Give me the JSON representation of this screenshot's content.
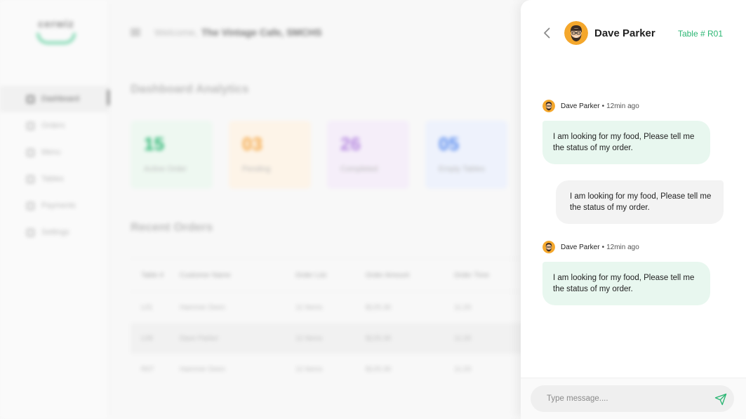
{
  "background": {
    "logo": {
      "text": "cerwiz"
    },
    "nav": [
      {
        "label": "Dashboard",
        "active": true
      },
      {
        "label": "Orders",
        "active": false
      },
      {
        "label": "Menu",
        "active": false
      },
      {
        "label": "Tables",
        "active": false
      },
      {
        "label": "Payments",
        "active": false
      },
      {
        "label": "Settings",
        "active": false
      }
    ],
    "header": {
      "welcome": "Welcome,",
      "venue": "The Vintage Cafe, SMCHS"
    },
    "analytics_title": "Dashboard Analytics",
    "cards": [
      {
        "value": "15",
        "label": "Active Order",
        "color": "#2bb673",
        "bg": "#eef8f1"
      },
      {
        "value": "03",
        "label": "Pending",
        "color": "#f5a94a",
        "bg": "#fdf4e8"
      },
      {
        "value": "26",
        "label": "Completed",
        "color": "#b68ae0",
        "bg": "#f5eef9"
      },
      {
        "value": "05",
        "label": "Empty Tables",
        "color": "#5b8def",
        "bg": "#eef2fc"
      }
    ],
    "recent_title": "Recent Orders",
    "table": {
      "columns": [
        "Table #",
        "Customer Name",
        "Order List",
        "Order Amount",
        "Order Time"
      ],
      "rows": [
        [
          "L01",
          "Hammer Deen",
          "12 Items",
          "$125.30",
          "11:20"
        ],
        [
          "L09",
          "Dave Parker",
          "12 Items",
          "$125.30",
          "11:20"
        ],
        [
          "R07",
          "Hammer Deen",
          "12 Items",
          "$125.30",
          "11:20"
        ]
      ]
    }
  },
  "chat": {
    "contact_name": "Dave Parker",
    "table_label": "Table # R01",
    "messages": [
      {
        "direction": "in",
        "sender": "Dave Parker",
        "time": "12min ago",
        "text": "I am looking for my food, Please tell me the status of my order."
      },
      {
        "direction": "out",
        "text": "I am looking for my food, Please tell me the status of my order."
      },
      {
        "direction": "in",
        "sender": "Dave Parker",
        "time": "12min ago",
        "text": "I am looking for my food, Please tell me the status of my order."
      }
    ],
    "composer": {
      "placeholder": "Type message....",
      "value": ""
    },
    "colors": {
      "accent": "#2bb673",
      "incoming_bubble": "#e8f7ef",
      "outgoing_bubble": "#f3f3f3"
    },
    "icons": {
      "back": "chevron-left-icon",
      "send": "send-icon"
    }
  }
}
